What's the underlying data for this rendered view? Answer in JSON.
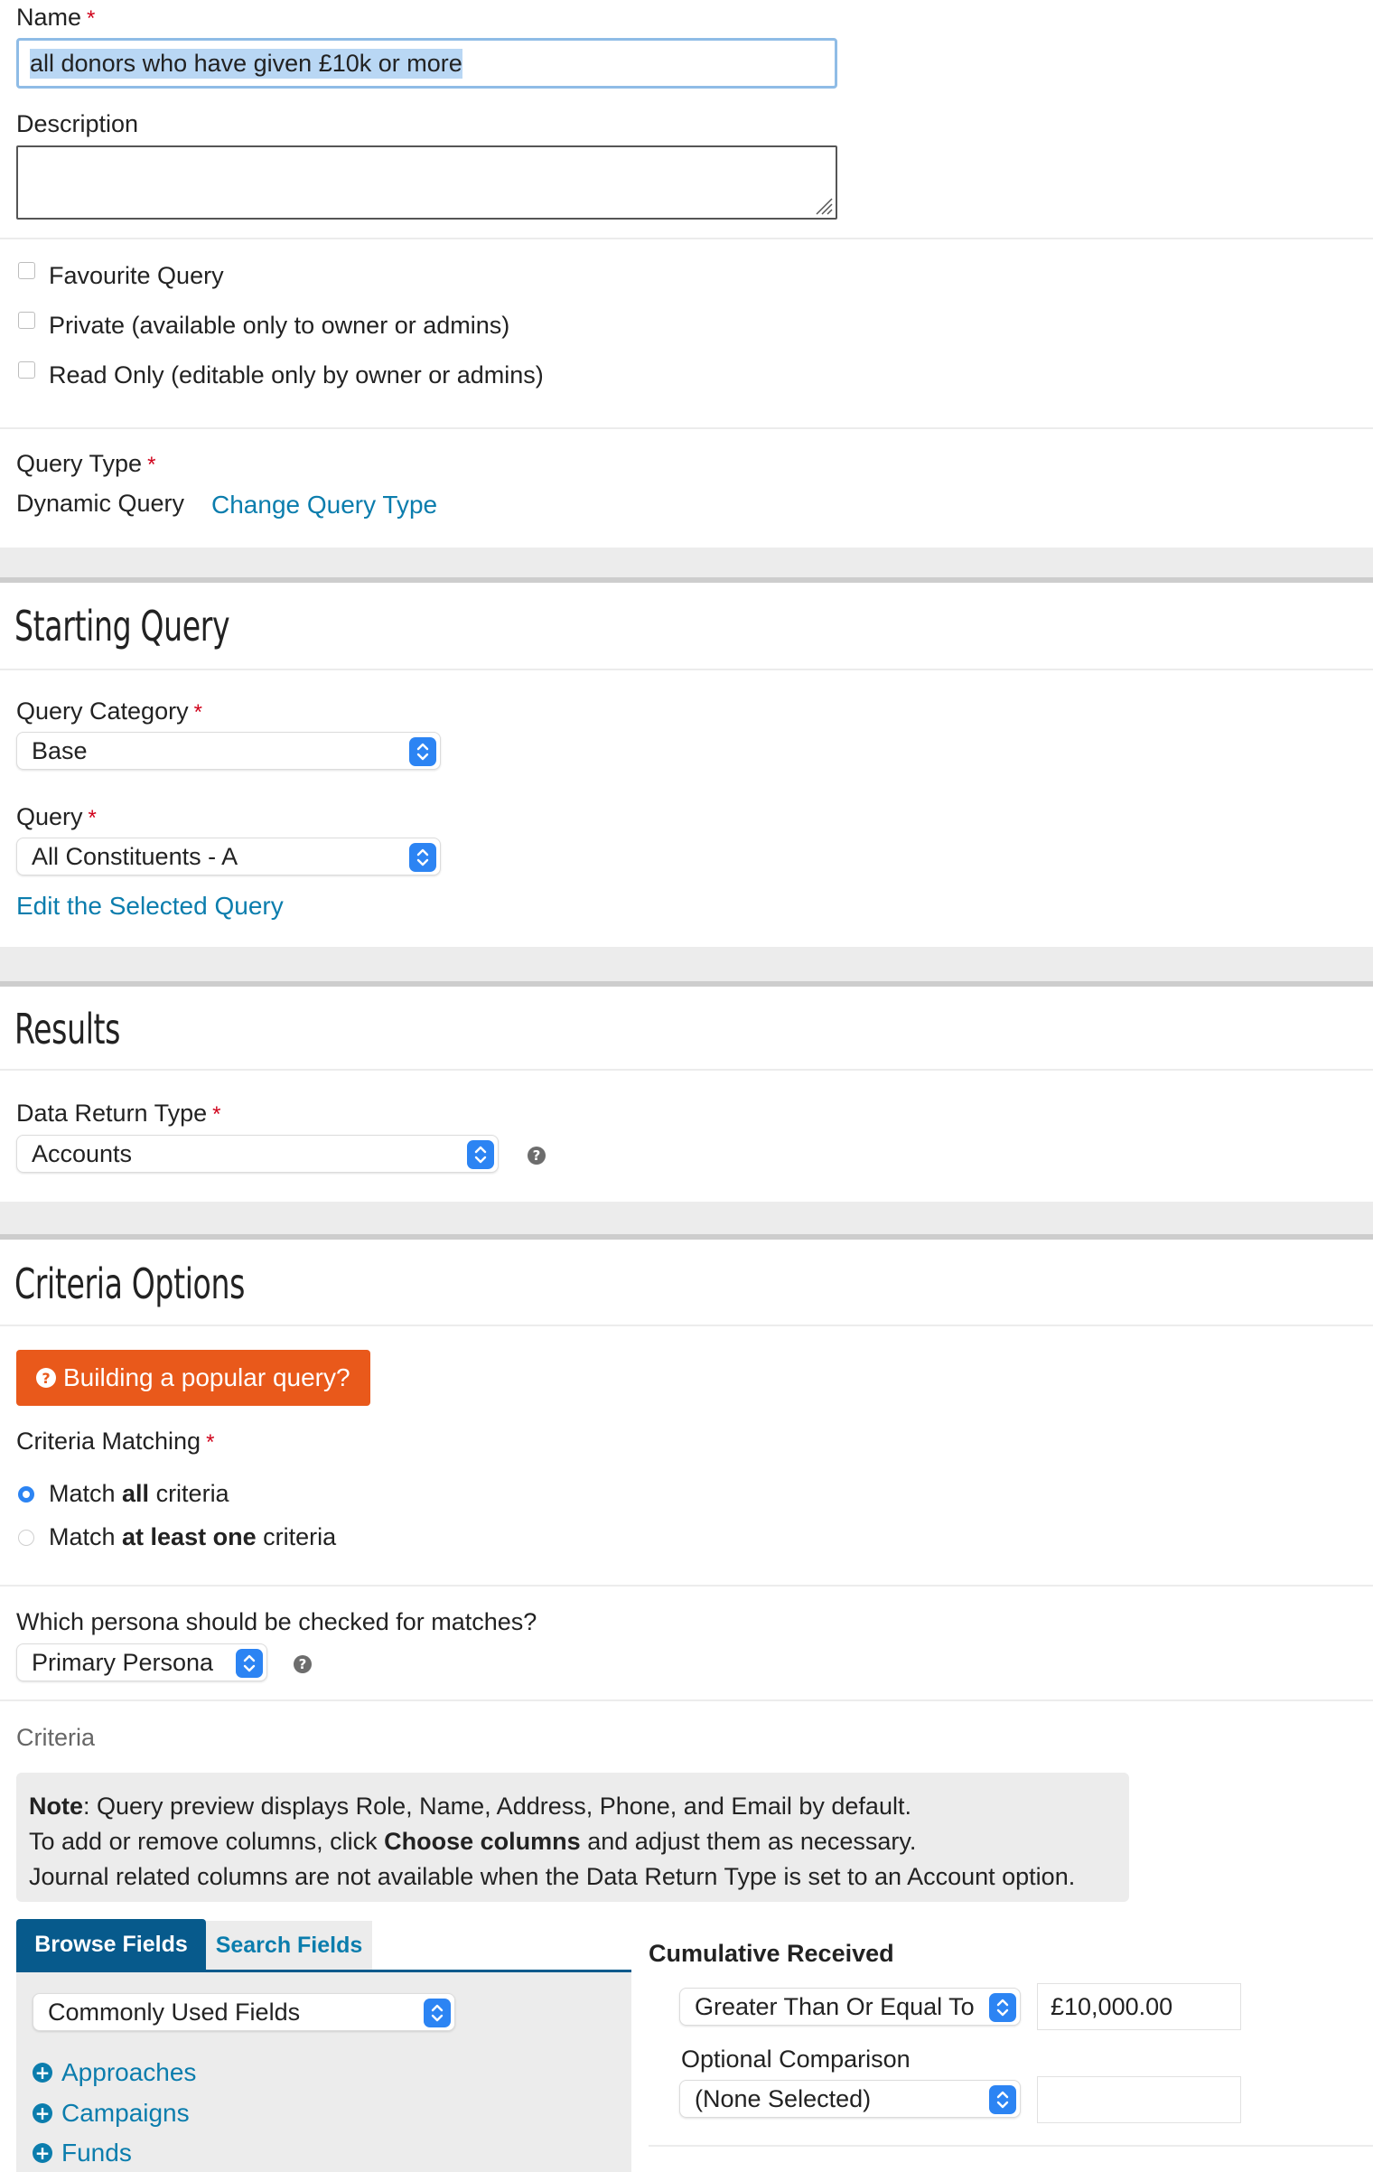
{
  "form": {
    "name_label": "Name",
    "name_value": "all donors who have given £10k or more",
    "description_label": "Description",
    "description_value": "",
    "checkboxes": [
      {
        "label": "Favourite Query",
        "checked": false
      },
      {
        "label": "Private (available only to owner or admins)",
        "checked": false
      },
      {
        "label": "Read Only (editable only by owner or admins)",
        "checked": false
      }
    ],
    "query_type_label": "Query Type",
    "query_type_value": "Dynamic Query",
    "change_query_type_link": "Change Query Type",
    "required_marker": "*"
  },
  "starting_query": {
    "title": "Starting Query",
    "category_label": "Query Category",
    "category_value": "Base",
    "query_label": "Query",
    "query_value": "All Constituents - A",
    "edit_link": "Edit the Selected Query"
  },
  "results": {
    "title": "Results",
    "data_return_label": "Data Return Type",
    "data_return_value": "Accounts"
  },
  "criteria_options": {
    "title": "Criteria Options",
    "popular_button": "Building a popular query?",
    "matching_label": "Criteria Matching",
    "match_all": {
      "prefix": "Match ",
      "bold": "all",
      "suffix": " criteria",
      "selected": true
    },
    "match_one": {
      "prefix": "Match ",
      "bold": "at least one",
      "suffix": " criteria",
      "selected": false
    },
    "persona_question": "Which persona should be checked for matches?",
    "persona_value": "Primary Persona",
    "criteria_heading": "Criteria",
    "note": {
      "bold1": "Note",
      "line1": ": Query preview displays Role, Name, Address, Phone, and Email by default.",
      "line2_prefix": "To add or remove columns, click ",
      "line2_bold": "Choose columns",
      "line2_suffix": " and adjust them as necessary.",
      "line3": "Journal related columns are not available when the Data Return Type is set to an Account option."
    },
    "tabs": [
      "Browse Fields",
      "Search Fields"
    ],
    "fields_select": "Commonly Used Fields",
    "tree_items": [
      "Approaches",
      "Campaigns",
      "Funds"
    ],
    "cumulative_heading": "Cumulative Received",
    "comparison_value": "Greater Than Or Equal To",
    "amount_value": "£10,000.00",
    "optional_label": "Optional Comparison",
    "optional_value": "(None Selected)",
    "optional_amount": ""
  },
  "colors": {
    "accent": "#2c84f3",
    "link": "#0b7dad",
    "orange": "#e9591b",
    "tab_active": "#075a8c",
    "required": "#d0021b"
  }
}
